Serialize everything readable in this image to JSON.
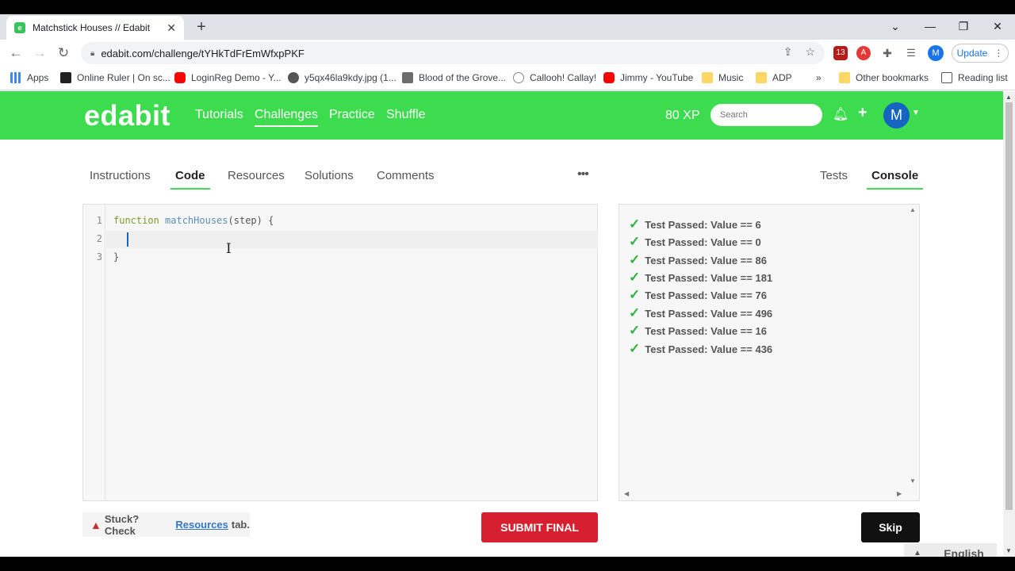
{
  "browser": {
    "tab_title": "Matchstick Houses // Edabit",
    "tab_close": "✕",
    "new_tab": "+",
    "url": "edabit.com/challenge/tYHkTdFrEmWfxpPKF",
    "update_label": "Update",
    "profile_initial": "M",
    "ext_badge": "13",
    "bookmarks": [
      {
        "label": "Apps"
      },
      {
        "label": "Online Ruler | On sc..."
      },
      {
        "label": "LoginReg Demo - Y..."
      },
      {
        "label": "y5qx46la9kdy.jpg (1..."
      },
      {
        "label": "Blood of the Grove..."
      },
      {
        "label": "Callooh! Callay!"
      },
      {
        "label": "Jimmy - YouTube"
      },
      {
        "label": "Music"
      },
      {
        "label": "ADP"
      }
    ],
    "bookmarks_overflow": "»",
    "other_bookmarks": "Other bookmarks",
    "reading_list": "Reading list"
  },
  "site": {
    "logo": "edabit",
    "nav": [
      {
        "label": "Tutorials"
      },
      {
        "label": "Challenges"
      },
      {
        "label": "Practice"
      },
      {
        "label": "Shuffle"
      }
    ],
    "xp": "80 XP",
    "search_placeholder": "Search",
    "profile_initial": "M"
  },
  "tabs": {
    "left": [
      "Instructions",
      "Code",
      "Resources",
      "Solutions",
      "Comments"
    ],
    "right": [
      "Tests",
      "Console"
    ],
    "more": "•••"
  },
  "editor": {
    "line_numbers": [
      "1",
      "2",
      "3"
    ],
    "line1_kw": "function",
    "line1_fn": "matchHouses",
    "line1_rest": "(step) {",
    "line3": "}"
  },
  "console": {
    "check_glyph": "✓",
    "results": [
      "Test Passed: Value == 6",
      "Test Passed: Value == 0",
      "Test Passed: Value == 86",
      "Test Passed: Value == 181",
      "Test Passed: Value == 76",
      "Test Passed: Value == 496",
      "Test Passed: Value == 16",
      "Test Passed: Value == 436"
    ]
  },
  "footer": {
    "stuck_prefix": "Stuck? Check",
    "stuck_link": "Resources",
    "stuck_suffix": "tab.",
    "submit": "SUBMIT FINAL",
    "skip": "Skip",
    "language": "English"
  },
  "colors": {
    "brand_green": "#3ddc4e",
    "submit_red": "#d7202f",
    "pass_green": "#2fb344"
  }
}
